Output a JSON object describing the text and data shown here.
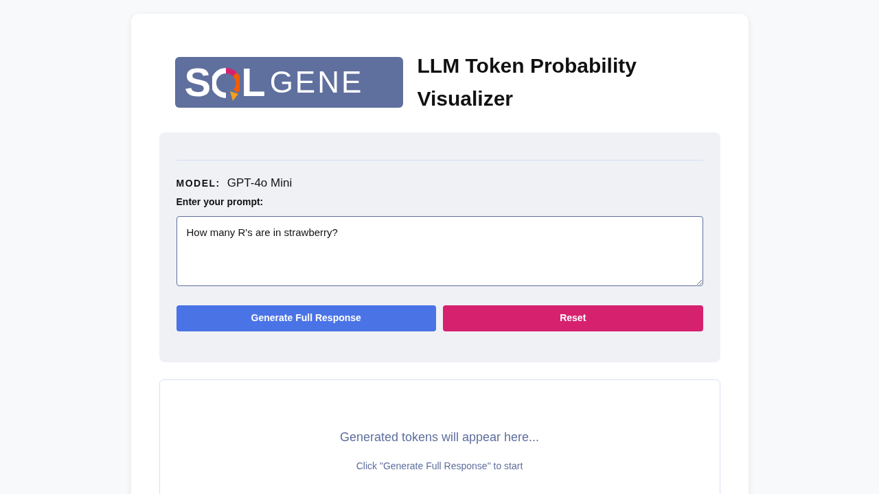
{
  "logo": {
    "lead": "S",
    "mark": "L",
    "word": "GENE"
  },
  "title": "LLM Token Probability Visualizer",
  "model": {
    "label": "MODEL:",
    "value": "GPT-4o Mini"
  },
  "prompt": {
    "label": "Enter your prompt:",
    "value": "How many R's are in strawberry?"
  },
  "buttons": [
    {
      "label": "Generate Full Response",
      "kind": "primary"
    },
    {
      "label": "Reset",
      "kind": "danger"
    }
  ],
  "output": {
    "message": "Generated tokens will appear here...",
    "hint": "Click \"Generate Full Response\" to start"
  }
}
